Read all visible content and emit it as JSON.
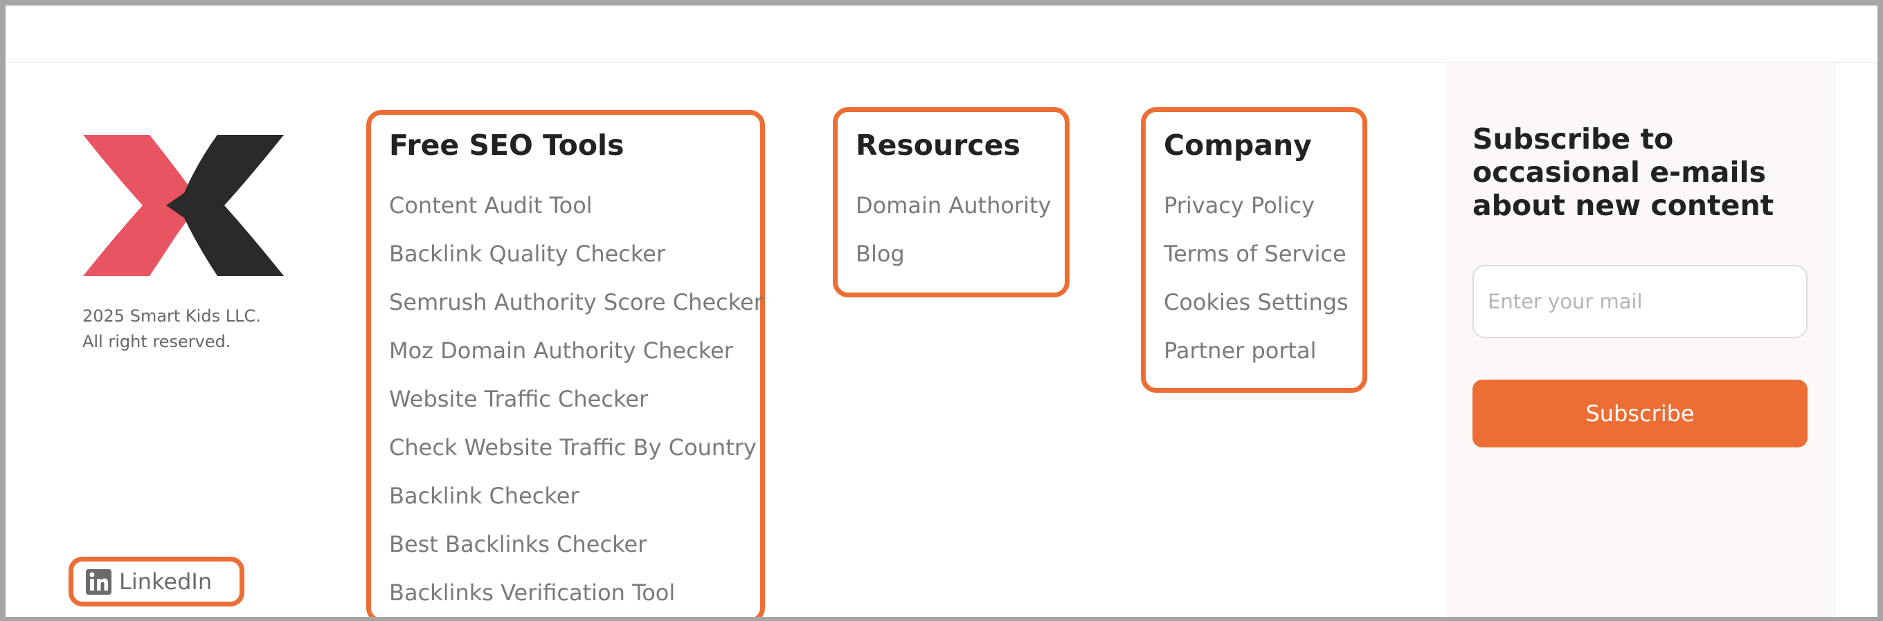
{
  "brand": {
    "copyright_line1": "2025 Smart Kids LLC.",
    "copyright_line2": "All right reserved.",
    "logo_colors": {
      "left": "#e95463",
      "right": "#2a2a2a"
    },
    "social": {
      "icon": "linkedin-icon",
      "label": "LinkedIn"
    }
  },
  "columns": {
    "seo_tools": {
      "title": "Free SEO Tools",
      "links": [
        "Content Audit Tool",
        "Backlink Quality Checker",
        "Semrush Authority Score Checker",
        "Moz Domain Authority Checker",
        "Website Traffic Checker",
        "Check Website Traffic By Country",
        "Backlink Checker",
        "Best Backlinks Checker",
        "Backlinks Verification Tool"
      ]
    },
    "resources": {
      "title": "Resources",
      "links": [
        "Domain Authority",
        "Blog"
      ]
    },
    "company": {
      "title": "Company",
      "links": [
        "Privacy Policy",
        "Terms of Service",
        "Cookies Settings",
        "Partner portal"
      ]
    }
  },
  "subscribe": {
    "heading": "Subscribe to occasional e-mails about new content",
    "email_placeholder": "Enter your mail",
    "email_value": "",
    "button_label": "Subscribe"
  },
  "colors": {
    "accent": "#ec6e35",
    "panel_bg": "#fcf8f8",
    "link_text": "#7a7a7a",
    "heading_text": "#222222"
  }
}
